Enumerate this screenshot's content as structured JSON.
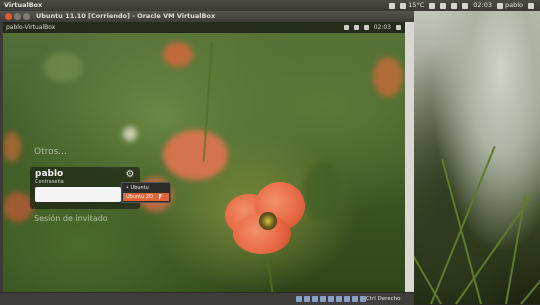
{
  "host_panel": {
    "app_title": "VirtualBox",
    "temperature": "15°C",
    "time": "02:03",
    "user": "pablo"
  },
  "vbox_window": {
    "title": "Ubuntu 11.10 [Corriendo] - Oracle VM VirtualBox",
    "status_host_key": "Ctrl Derecho"
  },
  "guest_panel": {
    "hostname": "pablo-VirtualBox",
    "time": "02:03"
  },
  "greeter": {
    "other_label": "Otros...",
    "user_name": "pablo",
    "password_label": "Contraseña",
    "session_options": [
      "Ubuntu",
      "Ubuntu 2D"
    ],
    "selected_session_index": 1,
    "guest_session_label": "Sesión de invitado"
  },
  "colors": {
    "accent_orange": "#e0663a",
    "close_button": "#e0582c",
    "panel_dark": "#3c3b37"
  },
  "icons": [
    "dropbox-icon",
    "network-icon",
    "mail-icon",
    "battery-icon",
    "volume-icon",
    "power-icon",
    "accessibility-icon"
  ]
}
